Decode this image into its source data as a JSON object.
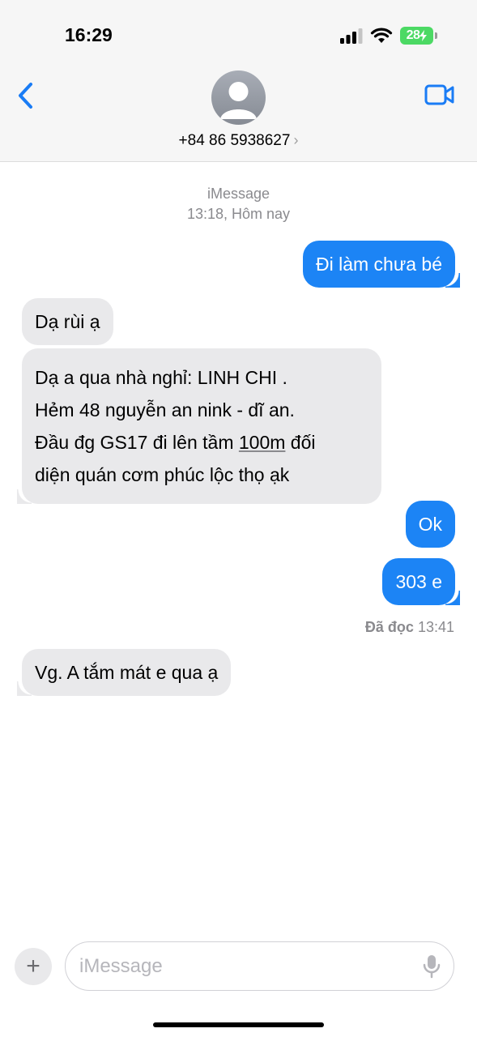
{
  "status_bar": {
    "time": "16:29",
    "battery": "28"
  },
  "header": {
    "contact": "+84 86 5938627",
    "contact_chevron": "›"
  },
  "thread": {
    "service": "iMessage",
    "date": "13:18, Hôm nay",
    "messages": [
      {
        "direction": "outgoing",
        "text": "Đi làm chưa bé"
      },
      {
        "direction": "incoming",
        "text": "Dạ rùi ạ"
      },
      {
        "direction": "incoming",
        "lines": [
          "Dạ a qua nhà nghỉ: LINH CHI .",
          "Hẻm 48 nguyễn an nink - dĩ an.",
          "Đầu đg GS17 đi lên tầm ",
          "100m",
          " đối",
          "diện quán cơm phúc lộc thọ ạk"
        ]
      },
      {
        "direction": "outgoing",
        "text": "Ok"
      },
      {
        "direction": "outgoing",
        "text": "303 e"
      },
      {
        "direction": "incoming",
        "text": "Vg. A tắm mát e qua ạ"
      }
    ],
    "read_receipt": {
      "label": "Đã đọc",
      "time": "13:41"
    }
  },
  "composer": {
    "plus": "+",
    "placeholder": "iMessage"
  },
  "colors": {
    "outgoing": "#1c84f5",
    "incoming": "#e9e9eb",
    "accent": "#1a7cf5"
  },
  "icons": [
    "signal-icon",
    "wifi-icon",
    "battery-icon",
    "back-chevron-icon",
    "video-call-icon",
    "avatar-person-icon",
    "plus-icon",
    "microphone-icon"
  ]
}
